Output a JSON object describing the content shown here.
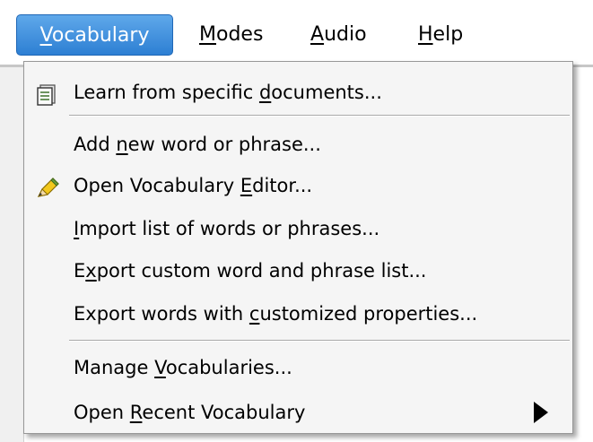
{
  "menubar": {
    "items": [
      {
        "pre": "",
        "key": "V",
        "post": "ocabulary"
      },
      {
        "pre": "",
        "key": "M",
        "post": "odes"
      },
      {
        "pre": "",
        "key": "A",
        "post": "udio"
      },
      {
        "pre": "",
        "key": "H",
        "post": "elp"
      }
    ]
  },
  "dropdown": {
    "items": [
      {
        "pre": "Learn from specific ",
        "key": "d",
        "post": "ocuments...",
        "icon": "document-stack-icon"
      },
      {
        "pre": "Add ",
        "key": "n",
        "post": "ew word or phrase..."
      },
      {
        "pre": "Open Vocabulary ",
        "key": "E",
        "post": "ditor...",
        "icon": "pencil-icon"
      },
      {
        "pre": "",
        "key": "I",
        "post": "mport list of words or phrases..."
      },
      {
        "pre": "E",
        "key": "x",
        "post": "port custom word and phrase list..."
      },
      {
        "pre": "Export words with ",
        "key": "c",
        "post": "ustomized properties..."
      },
      {
        "pre": "Manage ",
        "key": "V",
        "post": "ocabularies..."
      },
      {
        "pre": "Open ",
        "key": "R",
        "post": "ecent Vocabulary",
        "icon": "submenu-arrow-icon"
      }
    ]
  },
  "colors": {
    "highlight": "#3a8ad8",
    "menu_bg": "#f5f5f5",
    "border": "#979797"
  }
}
